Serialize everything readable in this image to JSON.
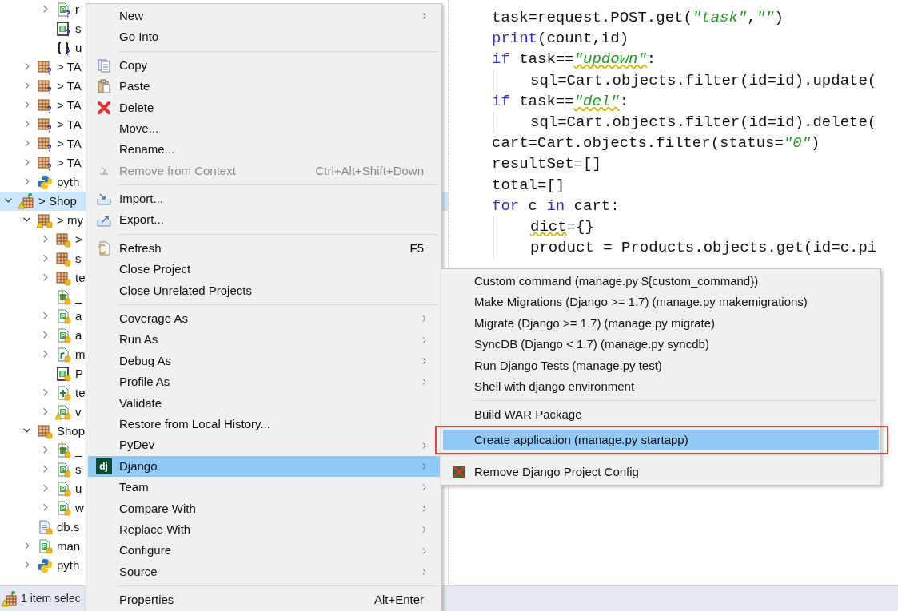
{
  "tree": [
    {
      "children": [
        {
          "children": [
            {
              "label": "r",
              "kind": "module",
              "unversioned": true,
              "tracked": false,
              "warning": false,
              "expanded": false,
              "selected": false
            },
            {
              "label": "s",
              "kind": "sql",
              "unversioned": true,
              "tracked": false,
              "warning": false,
              "selected": false
            },
            {
              "label": "u",
              "kind": "braces",
              "unversioned": true,
              "tracked": false,
              "warning": false,
              "selected": false
            }
          ]
        },
        {
          "label": "> TA",
          "kind": "package",
          "unversioned": true,
          "tracked": false,
          "warning": false,
          "expanded": false,
          "selected": false
        },
        {
          "label": "> TA",
          "kind": "package",
          "unversioned": true,
          "tracked": false,
          "warning": false,
          "expanded": false,
          "selected": false
        },
        {
          "label": "> TA",
          "kind": "package",
          "unversioned": true,
          "tracked": false,
          "warning": false,
          "expanded": false,
          "selected": false
        },
        {
          "label": "> TA",
          "kind": "package",
          "unversioned": true,
          "tracked": false,
          "warning": false,
          "expanded": false,
          "selected": false
        },
        {
          "label": "> TA",
          "kind": "package",
          "unversioned": true,
          "tracked": false,
          "warning": false,
          "expanded": false,
          "selected": false
        },
        {
          "label": "> TA",
          "kind": "package",
          "unversioned": true,
          "tracked": false,
          "warning": false,
          "expanded": false,
          "selected": false
        },
        {
          "label": "pyth",
          "kind": "python",
          "unversioned": false,
          "tracked": false,
          "warning": false,
          "expanded": false,
          "selected": false
        }
      ]
    },
    {
      "label": "> Shop",
      "kind": "project",
      "unversioned": false,
      "tracked": false,
      "warning": true,
      "expanded": true,
      "selected": true,
      "children": [
        {
          "label": "> my",
          "kind": "package",
          "unversioned": false,
          "tracked": true,
          "warning": true,
          "expanded": true,
          "selected": false,
          "children": [
            {
              "label": ">",
              "kind": "package",
              "unversioned": false,
              "tracked": true,
              "warning": false,
              "expanded": false,
              "selected": false
            },
            {
              "label": "s",
              "kind": "package",
              "unversioned": false,
              "tracked": true,
              "warning": false,
              "expanded": false,
              "selected": false
            },
            {
              "label": "te",
              "kind": "package",
              "unversioned": false,
              "tracked": true,
              "warning": false,
              "expanded": false,
              "selected": false
            },
            {
              "label": "_",
              "kind": "init",
              "unversioned": false,
              "tracked": true,
              "warning": false,
              "selected": false
            },
            {
              "label": "a",
              "kind": "module",
              "unversioned": false,
              "tracked": true,
              "warning": false,
              "expanded": false,
              "selected": false
            },
            {
              "label": "a",
              "kind": "module",
              "unversioned": false,
              "tracked": true,
              "warning": false,
              "expanded": false,
              "selected": false
            },
            {
              "label": "m",
              "kind": "resource",
              "unversioned": false,
              "tracked": true,
              "warning": false,
              "expanded": false,
              "selected": false
            },
            {
              "label": "P",
              "kind": "sql",
              "unversioned": false,
              "tracked": true,
              "warning": false,
              "selected": false
            },
            {
              "label": "te",
              "kind": "test",
              "unversioned": false,
              "tracked": true,
              "warning": false,
              "expanded": false,
              "selected": false
            },
            {
              "label": "v",
              "kind": "module",
              "unversioned": false,
              "tracked": true,
              "warning": true,
              "expanded": false,
              "selected": false
            }
          ]
        },
        {
          "label": "Shop",
          "kind": "package",
          "unversioned": false,
          "tracked": true,
          "warning": false,
          "expanded": true,
          "selected": false,
          "children": [
            {
              "label": "_",
              "kind": "init",
              "unversioned": false,
              "tracked": true,
              "warning": false,
              "expanded": false,
              "selected": false
            },
            {
              "label": "s",
              "kind": "module",
              "unversioned": false,
              "tracked": true,
              "warning": false,
              "expanded": false,
              "selected": false
            },
            {
              "label": "u",
              "kind": "module",
              "unversioned": false,
              "tracked": true,
              "warning": false,
              "expanded": false,
              "selected": false
            },
            {
              "label": "w",
              "kind": "module",
              "unversioned": false,
              "tracked": true,
              "warning": false,
              "expanded": false,
              "selected": false
            }
          ]
        },
        {
          "label": "db.s",
          "kind": "text",
          "unversioned": false,
          "tracked": true,
          "warning": false,
          "selected": false
        },
        {
          "label": "man",
          "kind": "module",
          "unversioned": false,
          "tracked": true,
          "warning": false,
          "expanded": false,
          "selected": false
        },
        {
          "label": "pyth",
          "kind": "python",
          "unversioned": false,
          "tracked": false,
          "warning": false,
          "expanded": false,
          "selected": false
        }
      ]
    }
  ],
  "editor": {
    "lines": [
      {
        "tokens": [
          {
            "text": "task=request.POST.get(",
            "kind": "plain"
          },
          {
            "text": "\"task\"",
            "kind": "string"
          },
          {
            "text": ",",
            "kind": "plain"
          },
          {
            "text": "\"\"",
            "kind": "string"
          },
          {
            "text": ")",
            "kind": "plain"
          }
        ]
      },
      {
        "tokens": [
          {
            "text": "print",
            "kind": "keyword"
          },
          {
            "text": "(count,id)",
            "kind": "plain"
          }
        ]
      },
      {
        "tokens": [
          {
            "text": "if",
            "kind": "keyword"
          },
          {
            "text": " task==",
            "kind": "plain"
          },
          {
            "text": "\"updown\"",
            "kind": "flagged"
          },
          {
            "text": ":",
            "kind": "plain"
          }
        ],
        "children": [
          {
            "tokens": [
              {
                "text": "sql=Cart.objects.filter(id=id).update(",
                "kind": "plain"
              }
            ]
          }
        ]
      },
      {
        "tokens": [
          {
            "text": "if",
            "kind": "keyword"
          },
          {
            "text": " task==",
            "kind": "plain"
          },
          {
            "text": "\"del\"",
            "kind": "flagged"
          },
          {
            "text": ":",
            "kind": "plain"
          }
        ],
        "children": [
          {
            "tokens": [
              {
                "text": "sql=Cart.objects.filter(id=id).delete(",
                "kind": "plain"
              }
            ]
          }
        ]
      },
      {
        "tokens": [
          {
            "text": "cart=Cart.objects.filter(status=",
            "kind": "plain"
          },
          {
            "text": "\"0\"",
            "kind": "string"
          },
          {
            "text": ")",
            "kind": "plain"
          }
        ]
      },
      {
        "tokens": [
          {
            "text": "resultSet=[]",
            "kind": "plain"
          }
        ]
      },
      {
        "tokens": [
          {
            "text": "total=[]",
            "kind": "plain"
          }
        ]
      },
      {
        "tokens": [
          {
            "text": "for",
            "kind": "keyword"
          },
          {
            "text": " c ",
            "kind": "plain"
          },
          {
            "text": "in",
            "kind": "keyword"
          },
          {
            "text": " cart:",
            "kind": "plain"
          }
        ],
        "children": [
          {
            "tokens": [
              {
                "text": "dict",
                "kind": "misspelled"
              },
              {
                "text": "={}",
                "kind": "plain"
              }
            ]
          },
          {
            "tokens": [
              {
                "text": "product = Products.objects.get(id=c.pi",
                "kind": "plain"
              }
            ]
          }
        ]
      }
    ]
  },
  "status_bar": {
    "text": "1 item selec"
  },
  "context_menu": [
    {
      "kind": "plain",
      "label": "New",
      "disabled": false,
      "submenu": true,
      "selected": false
    },
    {
      "kind": "plain",
      "label": "Go Into",
      "disabled": false,
      "submenu": false,
      "selected": false
    },
    {
      "kind": "separator"
    },
    {
      "kind": "copy",
      "label": "Copy",
      "disabled": false,
      "submenu": false,
      "selected": false
    },
    {
      "kind": "paste",
      "label": "Paste",
      "disabled": false,
      "submenu": false,
      "selected": false
    },
    {
      "kind": "delete",
      "label": "Delete",
      "disabled": false,
      "submenu": false,
      "selected": false
    },
    {
      "kind": "plain",
      "label": "Move...",
      "disabled": false,
      "submenu": false,
      "selected": false
    },
    {
      "kind": "plain",
      "label": "Rename...",
      "disabled": false,
      "submenu": false,
      "selected": false
    },
    {
      "kind": "unlink",
      "label": "Remove from Context",
      "shortcut": "Ctrl+Alt+Shift+Down",
      "disabled": true,
      "submenu": false,
      "selected": false
    },
    {
      "kind": "separator"
    },
    {
      "kind": "import",
      "label": "Import...",
      "disabled": false,
      "submenu": false,
      "selected": false
    },
    {
      "kind": "export",
      "label": "Export...",
      "disabled": false,
      "submenu": false,
      "selected": false
    },
    {
      "kind": "separator"
    },
    {
      "kind": "refresh",
      "label": "Refresh",
      "shortcut": "F5",
      "disabled": false,
      "submenu": false,
      "selected": false
    },
    {
      "kind": "plain",
      "label": "Close Project",
      "disabled": false,
      "submenu": false,
      "selected": false
    },
    {
      "kind": "plain",
      "label": "Close Unrelated Projects",
      "disabled": false,
      "submenu": false,
      "selected": false
    },
    {
      "kind": "separator"
    },
    {
      "kind": "plain",
      "label": "Coverage As",
      "disabled": false,
      "submenu": true,
      "selected": false
    },
    {
      "kind": "plain",
      "label": "Run As",
      "disabled": false,
      "submenu": true,
      "selected": false
    },
    {
      "kind": "plain",
      "label": "Debug As",
      "disabled": false,
      "submenu": true,
      "selected": false
    },
    {
      "kind": "plain",
      "label": "Profile As",
      "disabled": false,
      "submenu": true,
      "selected": false
    },
    {
      "kind": "plain",
      "label": "Validate",
      "disabled": false,
      "submenu": false,
      "selected": false
    },
    {
      "kind": "plain",
      "label": "Restore from Local History...",
      "disabled": false,
      "submenu": false,
      "selected": false
    },
    {
      "kind": "plain",
      "label": "PyDev",
      "disabled": false,
      "submenu": true,
      "selected": false
    },
    {
      "kind": "logo",
      "logo_text": "dj",
      "label": "Django",
      "disabled": false,
      "submenu": true,
      "selected": true
    },
    {
      "kind": "plain",
      "label": "Team",
      "disabled": false,
      "submenu": true,
      "selected": false
    },
    {
      "kind": "plain",
      "label": "Compare With",
      "disabled": false,
      "submenu": true,
      "selected": false
    },
    {
      "kind": "plain",
      "label": "Replace With",
      "disabled": false,
      "submenu": true,
      "selected": false
    },
    {
      "kind": "plain",
      "label": "Configure",
      "disabled": false,
      "submenu": true,
      "selected": false
    },
    {
      "kind": "plain",
      "label": "Source",
      "disabled": false,
      "submenu": true,
      "selected": false
    },
    {
      "kind": "separator"
    },
    {
      "kind": "plain",
      "label": "Properties",
      "shortcut": "Alt+Enter",
      "disabled": false,
      "submenu": false,
      "selected": false
    }
  ],
  "django_submenu": [
    {
      "kind": "plain",
      "label": "Custom command (manage.py ${custom_command})",
      "selected": false,
      "boxed": false
    },
    {
      "kind": "plain",
      "label": "Make Migrations (Django >= 1.7) (manage.py makemigrations)",
      "selected": false,
      "boxed": false
    },
    {
      "kind": "plain",
      "label": "Migrate (Django >= 1.7) (manage.py migrate)",
      "selected": false,
      "boxed": false
    },
    {
      "kind": "plain",
      "label": "SyncDB (Django < 1.7) (manage.py syncdb)",
      "selected": false,
      "boxed": false
    },
    {
      "kind": "plain",
      "label": "Run Django Tests (manage.py test)",
      "selected": false,
      "boxed": false
    },
    {
      "kind": "plain",
      "label": "Shell with django environment",
      "selected": false,
      "boxed": false
    },
    {
      "kind": "separator"
    },
    {
      "kind": "plain",
      "label": "Build WAR Package",
      "selected": false,
      "boxed": false
    },
    {
      "kind": "plain",
      "label": "Create application (manage.py startapp)",
      "selected": true,
      "boxed": true
    },
    {
      "kind": "separator"
    },
    {
      "kind": "crossed",
      "label": "Remove Django Project Config",
      "selected": false,
      "boxed": false
    }
  ]
}
